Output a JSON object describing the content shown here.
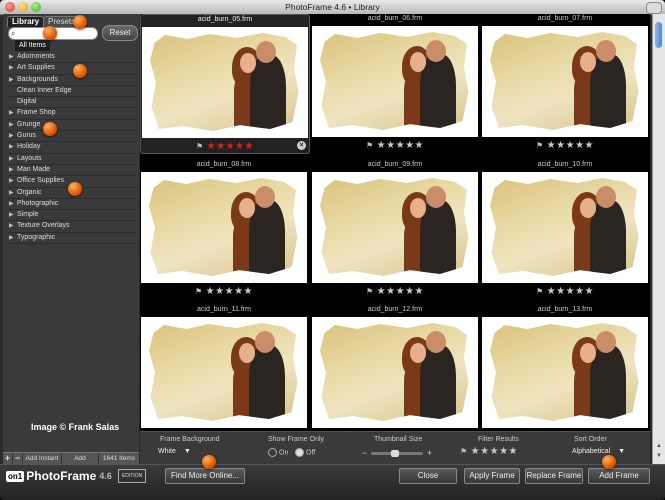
{
  "window": {
    "title": "PhotoFrame 4.6 • Library"
  },
  "sidebar": {
    "tabs": [
      {
        "label": "Library"
      },
      {
        "label": "Presets"
      }
    ],
    "search": {
      "value": "",
      "placeholder": ""
    },
    "reset_label": "Reset",
    "all_items_label": "All Items",
    "categories": [
      "Adornments",
      "Art Supplies",
      "Backgrounds",
      "Clean Inner Edge",
      "Digital",
      "Frame Shop",
      "Grunge",
      "Gurus",
      "Holiday",
      "Layouts",
      "Man Made",
      "Office Supplies",
      "Organic",
      "Photographic",
      "Simple",
      "Texture Overlays",
      "Typographic"
    ],
    "credit": "Image © Frank Salas",
    "bottom": {
      "plus": "+",
      "minus": "−",
      "add_instant": "Add Instant",
      "add_random": "Add Random",
      "count": "1641 Items"
    }
  },
  "grid": {
    "tiles": [
      {
        "name": "acid_burn_05.frm",
        "rating": 5,
        "selected": true
      },
      {
        "name": "acid_burn_06.frm",
        "rating": 0
      },
      {
        "name": "acid_burn_07.frm",
        "rating": 0
      },
      {
        "name": "acid_burn_08.frm",
        "rating": 0
      },
      {
        "name": "acid_burn_09.frm",
        "rating": 0
      },
      {
        "name": "acid_burn_10.frm",
        "rating": 0
      },
      {
        "name": "acid_burn_11.frm",
        "rating": 0
      },
      {
        "name": "acid_burn_12.frm",
        "rating": 0
      },
      {
        "name": "acid_burn_13.frm",
        "rating": 0
      }
    ]
  },
  "controls": {
    "frame_background_label": "Frame Background",
    "frame_background_value": "White",
    "show_frame_only_label": "Show Frame Only",
    "on_label": "On",
    "off_label": "Off",
    "thumbnail_size_label": "Thumbnail Size",
    "thumbnail_size_value": 0.45,
    "filter_results_label": "Filter Results",
    "sort_order_label": "Sort Order",
    "sort_order_value": "Alphabetical"
  },
  "footer": {
    "logo_mark": "on1",
    "logo_name": "PhotoFrame",
    "logo_version": "4.6",
    "edition": "EDITION",
    "find_more": "Find More Online...",
    "close": "Close",
    "apply": "Apply Frame",
    "replace": "Replace Frame",
    "add": "Add Frame"
  },
  "colors": {
    "rating_active": "#e0201a",
    "marker": "#e05a00"
  }
}
